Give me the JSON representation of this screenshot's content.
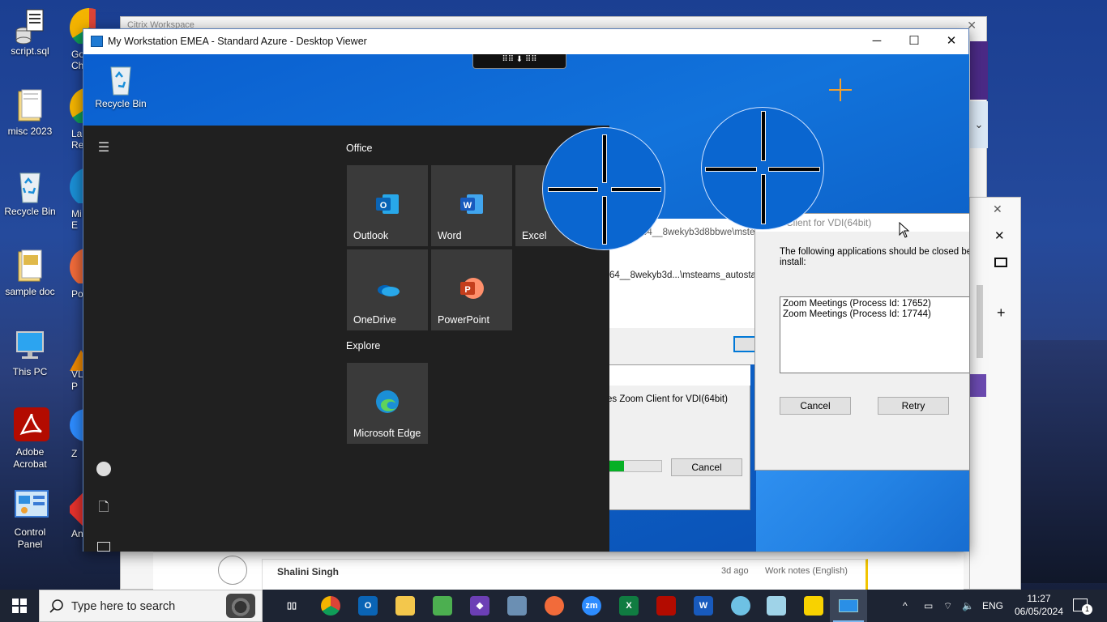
{
  "desktop": {
    "icons": [
      {
        "label": "script.sql",
        "name": "desktop-icon-script-sql"
      },
      {
        "label": "misc 2023",
        "name": "desktop-icon-misc-2023"
      },
      {
        "label": "Recycle Bin",
        "name": "desktop-icon-recycle-bin"
      },
      {
        "label": "sample doc",
        "name": "desktop-icon-sample-doc"
      },
      {
        "label": "This PC",
        "name": "desktop-icon-this-pc"
      },
      {
        "label": "Adobe Acrobat",
        "name": "desktop-icon-adobe-acrobat"
      },
      {
        "label": "Control Panel",
        "name": "desktop-icon-control-panel"
      }
    ],
    "partial_labels": [
      "Go",
      "Ch",
      "La",
      "Re",
      "Mi",
      "E",
      "Po",
      "VLC",
      "P",
      "Z",
      "An"
    ]
  },
  "background_window": {
    "partial_title": "Citrix Workspace",
    "comment_author": "Shalini Singh",
    "comment_age": "3d ago",
    "comment_tag": "Work notes (English)"
  },
  "viewer": {
    "title": "My Workstation EMEA - Standard Azure - Desktop Viewer"
  },
  "remote_desktop": {
    "recycle_bin_label": "Recycle Bin"
  },
  "start_menu": {
    "groups": [
      {
        "title": "Office",
        "tiles": [
          "Outlook",
          "Word",
          "Excel",
          "OneDrive",
          "PowerPoint"
        ]
      },
      {
        "title": "Explore",
        "tiles": [
          "Microsoft Edge"
        ]
      }
    ]
  },
  "installer_bg": {
    "path_line_1": "64__8wekyb3d8bbwe\\mste",
    "path_line_2": "64__8wekyb3d...\\msteams_autosta",
    "progress_text": "es Zoom Client for VDI(64bit)",
    "progress_value": 0.3,
    "cancel_label": "Cancel"
  },
  "zoom_dialog": {
    "title": "Client for VDI(64bit)",
    "message_line_1": "The following applications should be closed befor",
    "message_line_2": "install:",
    "processes": [
      "Zoom Meetings (Process Id: 17652)",
      "Zoom Meetings (Process Id: 17744)"
    ],
    "cancel_label": "Cancel",
    "retry_label": "Retry"
  },
  "taskbar": {
    "search_placeholder": "Type here to search",
    "language": "ENG",
    "time": "11:27",
    "date": "06/05/2024",
    "notification_count": "1",
    "apps": [
      "task-view",
      "chrome",
      "outlook",
      "file-explorer",
      "snipping",
      "visual-studio",
      "network-tool",
      "postman",
      "zoom",
      "excel",
      "acrobat",
      "word",
      "citrix",
      "notepad",
      "sticky-notes",
      "desktop-viewer"
    ]
  },
  "colors": {
    "accent": "#0078d7",
    "start_menu_bg": "#202020",
    "tile_bg": "#3a3a3a",
    "taskbar_bg": "#1d2433",
    "progress_green": "#06b025"
  }
}
